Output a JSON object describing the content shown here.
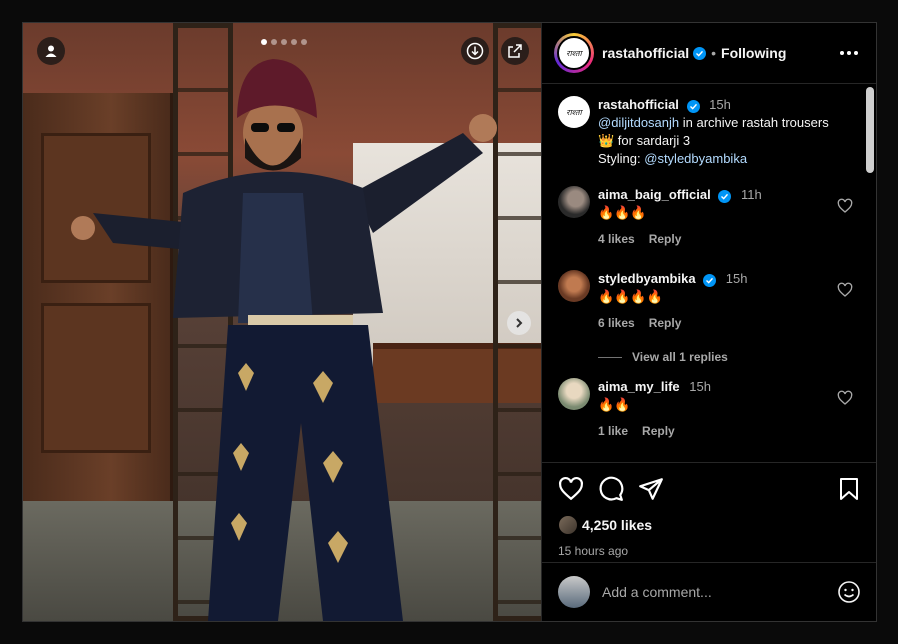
{
  "post": {
    "username": "rastahofficial",
    "follow_status": "Following",
    "caption_time": "15h",
    "caption_mention": "@diljitdosanjh",
    "caption_text_1": " in archive rastah trousers",
    "caption_line_2": "👑  for sardarji 3",
    "caption_styling_label": "Styling: ",
    "caption_styling_mention": "@styledbyambika",
    "avatar_script": "राश्ता",
    "carousel": {
      "slides": 5,
      "current": 1
    }
  },
  "comments": [
    {
      "username": "aima_baig_official",
      "verified": true,
      "time": "11h",
      "text": "🔥🔥🔥",
      "likes": "4 likes",
      "reply": "Reply",
      "avatar_color": "#3a3a3a"
    },
    {
      "username": "styledbyambika",
      "verified": true,
      "time": "15h",
      "text": "🔥🔥🔥🔥",
      "likes": "6 likes",
      "reply": "Reply",
      "avatar_color": "#8a4a30",
      "view_replies": "View all 1 replies"
    },
    {
      "username": "aima_my_life",
      "verified": false,
      "time": "15h",
      "text": "🔥🔥",
      "likes": "1 like",
      "reply": "Reply",
      "avatar_color": "#c8b8a0"
    }
  ],
  "actions": {
    "likes_count": "4,250 likes",
    "posted_ago": "15 hours ago"
  },
  "add_comment": {
    "placeholder": "Add a comment..."
  },
  "icons": {
    "media": [
      "user-icon",
      "download-icon",
      "share-out-icon",
      "chevron-right-icon"
    ],
    "actions": [
      "heart-icon",
      "comment-icon",
      "send-icon",
      "bookmark-icon",
      "emoji-icon",
      "more-icon"
    ]
  },
  "colors": {
    "link": "#b3dbff",
    "verified": "#0095f6",
    "muted": "#a8a8a8",
    "background": "#000000"
  }
}
